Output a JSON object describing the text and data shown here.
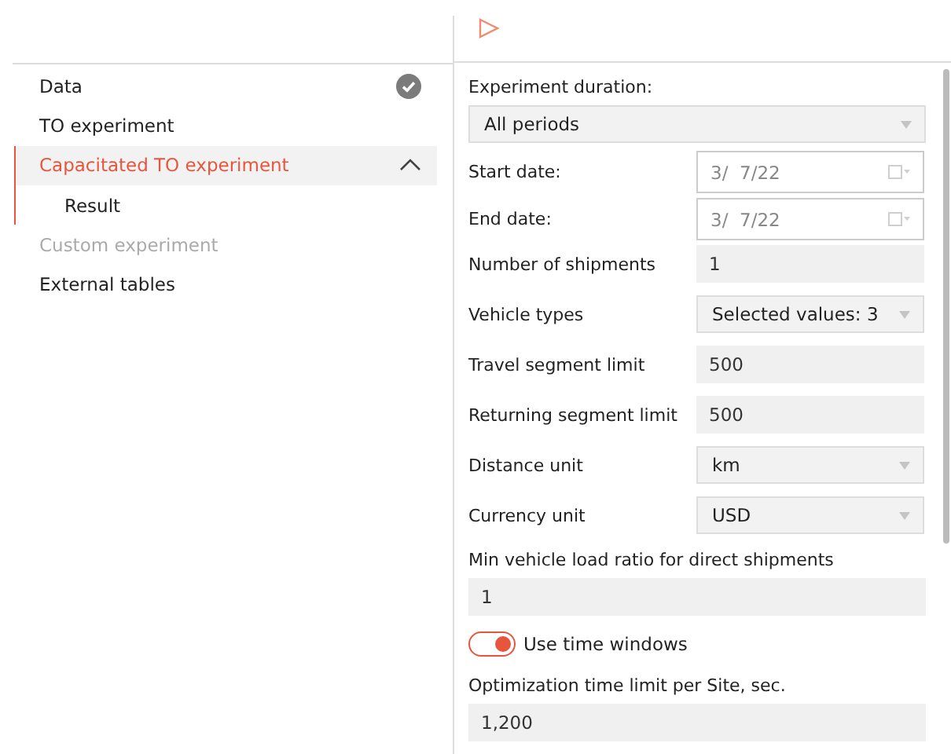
{
  "sidebar": {
    "items": [
      {
        "label": "Data",
        "selected": false,
        "disabled": false,
        "done": true
      },
      {
        "label": "TO experiment",
        "selected": false,
        "disabled": false,
        "done": false
      },
      {
        "label": "Capacitated TO experiment",
        "selected": true,
        "disabled": false,
        "done": false,
        "expanded": true,
        "children": [
          {
            "label": "Result",
            "selected": false,
            "disabled": false,
            "done": false
          }
        ]
      },
      {
        "label": "Custom experiment",
        "selected": false,
        "disabled": true,
        "done": false
      },
      {
        "label": "External tables",
        "selected": false,
        "disabled": false,
        "done": false
      }
    ]
  },
  "form": {
    "fields": [
      {
        "kind": "select-wide",
        "label": "Experiment duration:",
        "value": "All periods"
      },
      {
        "kind": "date",
        "label": "Start date:",
        "value": "3/  7/22"
      },
      {
        "kind": "date",
        "label": "End date:",
        "value": "3/  7/22"
      },
      {
        "kind": "text",
        "label": "Number of shipments",
        "value": "1"
      },
      {
        "kind": "select",
        "label": "Vehicle types",
        "value": "Selected values: 3"
      },
      {
        "kind": "text",
        "label": "Travel segment limit",
        "value": "500"
      },
      {
        "kind": "text",
        "label": "Returning segment limit",
        "value": "500"
      },
      {
        "kind": "select",
        "label": "Distance unit",
        "value": "km"
      },
      {
        "kind": "select",
        "label": "Currency unit",
        "value": "USD"
      },
      {
        "kind": "text-wide",
        "label": "Min vehicle load ratio for direct shipments",
        "value": "1"
      },
      {
        "kind": "toggle",
        "label": "Use time windows",
        "on": true
      },
      {
        "kind": "text-wide",
        "label": "Optimization time limit per Site, sec.",
        "value": "1,200"
      }
    ]
  }
}
